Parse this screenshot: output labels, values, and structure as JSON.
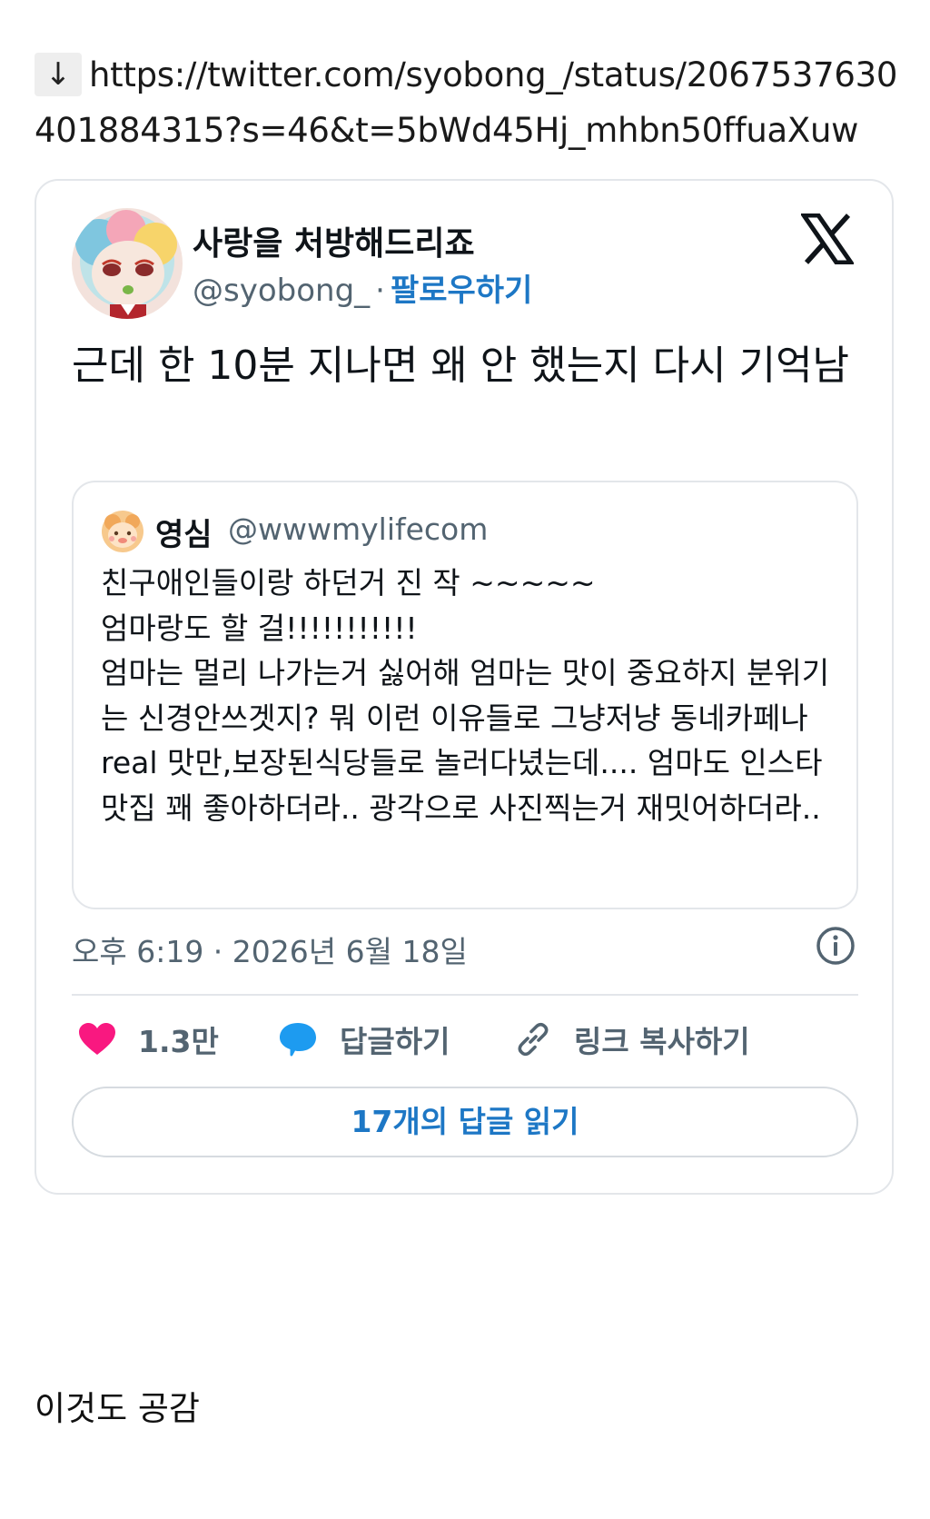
{
  "link": {
    "icon": "down-arrow-icon",
    "arrow_glyph": "↓",
    "url": "https://twitter.com/syobong_/status/2067537630401884315?s=46&t=5bWd45Hj_mhbn50ffuaXuw"
  },
  "tweet": {
    "author_name": "사랑을 처방해드리죠",
    "author_handle": "@syobong_",
    "separator": "·",
    "follow_label": "팔로우하기",
    "text": "근데 한 10분 지나면 왜 안 했는지 다시 기억남",
    "quote": {
      "author_name": "영심",
      "author_handle": "@wwwmylifecom",
      "text": "친구애인들이랑 하던거 진 작  ~~~~~\n엄마랑도 할 걸!!!!!!!!!!!\n엄마는 멀리 나가는거 싫어해 엄마는 맛이 중요하지 분위기는 신경안쓰겟지? 뭐 이런 이유들로 그냥저냥 동네카페나 real 맛만,보장된식당들로 놀러다녔는데.... 엄마도 인스타맛집 꽤 좋아하더라.. 광각으로 사진찍는거 재밋어하더라.."
    },
    "timestamp": "오후 6:19 · 2026년 6월 18일",
    "likes": "1.3만",
    "reply_label": "답글하기",
    "copy_link_label": "링크 복사하기",
    "read_replies_label": "17개의 답글 읽기",
    "colors": {
      "like": "#f91880",
      "reply": "#1d9bf0",
      "link": "#1d77c5",
      "muted": "#536471"
    }
  },
  "bottom_text": "이것도 공감"
}
